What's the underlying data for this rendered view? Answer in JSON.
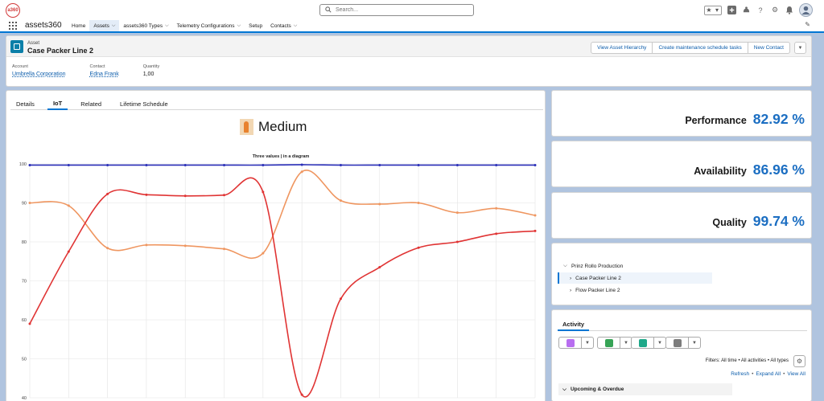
{
  "header": {
    "logo_text": "a360",
    "search_placeholder": "Search...",
    "icons": [
      "star-icon",
      "chevron-down-icon",
      "plus-icon",
      "trailhead-icon",
      "help-icon",
      "gear-icon",
      "bell-icon",
      "avatar"
    ]
  },
  "nav": {
    "app_name": "assets360",
    "items": [
      {
        "label": "Home",
        "dropdown": false,
        "active": false
      },
      {
        "label": "Assets",
        "dropdown": true,
        "active": true
      },
      {
        "label": "assets360 Types",
        "dropdown": true,
        "active": false
      },
      {
        "label": "Telemetry Configurations",
        "dropdown": true,
        "active": false
      },
      {
        "label": "Setup",
        "dropdown": false,
        "active": false
      },
      {
        "label": "Contacts",
        "dropdown": true,
        "active": false
      }
    ]
  },
  "record": {
    "type": "Asset",
    "name": "Case Packer Line 2",
    "actions": [
      "View Asset Hierarchy",
      "Create maintenance schedule tasks",
      "New Contact"
    ],
    "fields": [
      {
        "label": "Account",
        "value": "Umbrella Corporation",
        "link": true
      },
      {
        "label": "Contact",
        "value": "Edna Frank",
        "link": true
      },
      {
        "label": "Quantity",
        "value": "1,00",
        "link": false
      }
    ]
  },
  "tabs": {
    "items": [
      "Details",
      "IoT",
      "Related",
      "Lifetime Schedule"
    ],
    "active": "IoT"
  },
  "status": {
    "label": "Medium"
  },
  "chart_data": {
    "type": "line",
    "title": "Three values | in a diagram",
    "xlabel": "",
    "ylabel": "",
    "ylim": [
      40,
      100
    ],
    "yticks": [
      40,
      50,
      60,
      70,
      80,
      90,
      100
    ],
    "grid": true,
    "x": [
      0,
      1,
      2,
      3,
      4,
      5,
      6,
      7,
      8,
      9,
      10,
      11,
      12,
      13
    ],
    "series": [
      {
        "color": "#2a2fb8",
        "values": [
          99.7,
          99.7,
          99.7,
          99.7,
          99.7,
          99.7,
          99.7,
          99.8,
          99.7,
          99.7,
          99.7,
          99.7,
          99.7,
          99.7
        ]
      },
      {
        "color": "#ef9660",
        "values": [
          90.0,
          89.3,
          78.4,
          79.2,
          79.0,
          78.2,
          77.1,
          98.0,
          90.6,
          89.7,
          90.0,
          87.5,
          88.6,
          86.8
        ]
      },
      {
        "color": "#e03434",
        "values": [
          59.0,
          77.5,
          92.3,
          92.1,
          91.8,
          92.0,
          92.8,
          40.8,
          65.4,
          73.5,
          78.5,
          80.0,
          82.1,
          82.8
        ]
      }
    ]
  },
  "kpis": [
    {
      "label": "Performance",
      "value": "82.92 %"
    },
    {
      "label": "Availability",
      "value": "86.96 %"
    },
    {
      "label": "Quality",
      "value": "99.74 %"
    }
  ],
  "hierarchy": {
    "root": "Prinz Rollo Production",
    "children": [
      "Case Packer Line 2",
      "Flow Packer Line 2"
    ],
    "selected": "Case Packer Line 2"
  },
  "activity": {
    "tab": "Activity",
    "publisher_colors": [
      "#b86ef0",
      "#37a356",
      "#1fa889",
      "#7c7c7c"
    ],
    "filters": "Filters: All time • All activities • All types",
    "links": [
      "Refresh",
      "Expand All",
      "View All"
    ],
    "section": "Upcoming & Overdue"
  }
}
